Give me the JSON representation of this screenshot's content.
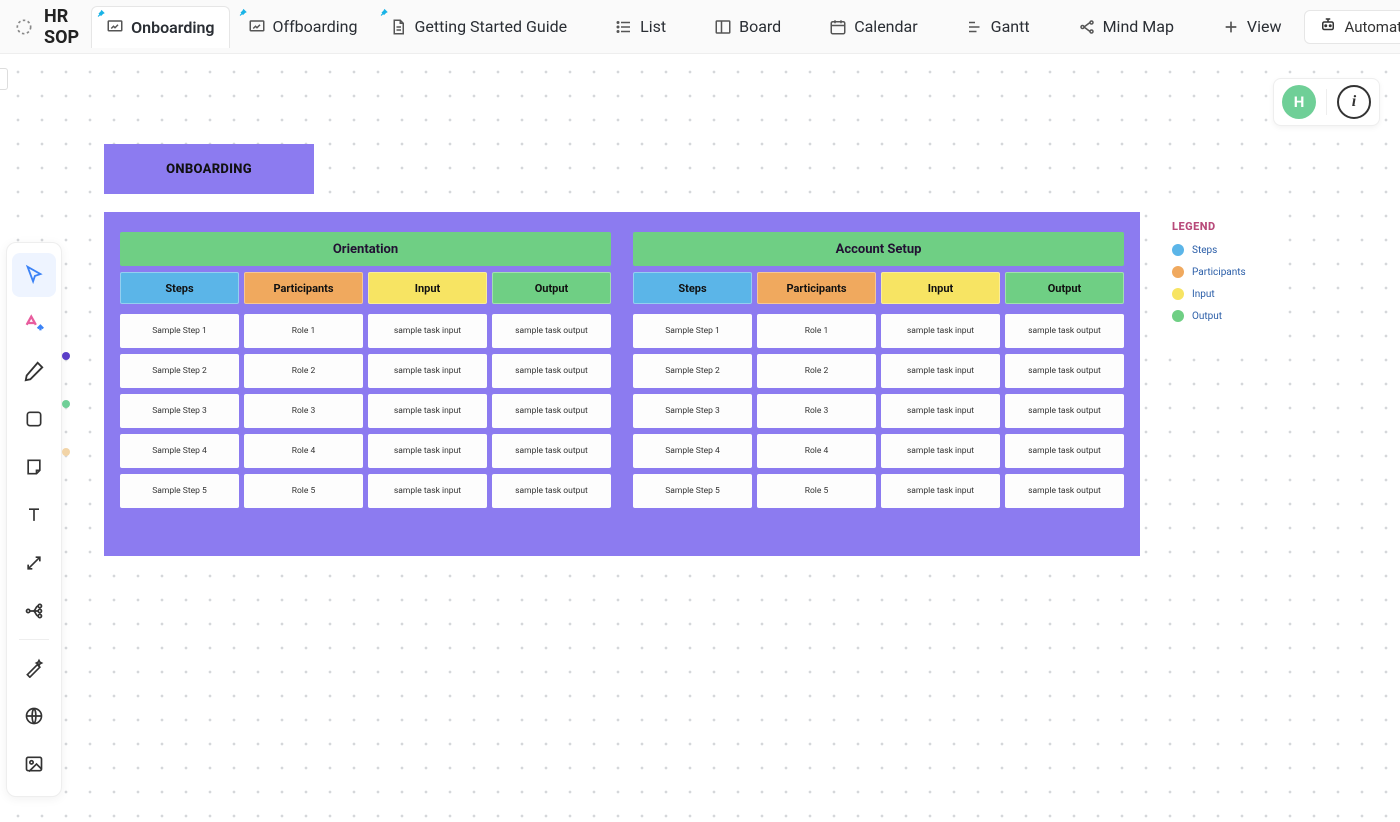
{
  "app": {
    "title": "HR SOP"
  },
  "tabs": [
    {
      "label": "Onboarding",
      "icon": "whiteboard",
      "pinned": true,
      "active": true
    },
    {
      "label": "Offboarding",
      "icon": "whiteboard",
      "pinned": true,
      "active": false
    },
    {
      "label": "Getting Started Guide",
      "icon": "doc",
      "pinned": true,
      "active": false
    },
    {
      "label": "List",
      "icon": "list",
      "pinned": false,
      "active": false
    },
    {
      "label": "Board",
      "icon": "board",
      "pinned": false,
      "active": false
    },
    {
      "label": "Calendar",
      "icon": "calendar",
      "pinned": false,
      "active": false
    },
    {
      "label": "Gantt",
      "icon": "gantt",
      "pinned": false,
      "active": false
    },
    {
      "label": "Mind Map",
      "icon": "mindmap",
      "pinned": false,
      "active": false
    },
    {
      "label": "View",
      "icon": "plus",
      "pinned": false,
      "active": false
    }
  ],
  "automate": {
    "label": "Automate"
  },
  "corner": {
    "avatar_letter": "H"
  },
  "tools": [
    "cursor",
    "ai",
    "pen",
    "rectangle",
    "sticky",
    "text",
    "connector",
    "branch",
    "magic",
    "web",
    "image"
  ],
  "board_title": "ONBOARDING",
  "columns": {
    "steps": {
      "label": "Steps",
      "color": "#5bb5e8"
    },
    "participants": {
      "label": "Participants",
      "color": "#f0a95e"
    },
    "input": {
      "label": "Input",
      "color": "#f7e463"
    },
    "output": {
      "label": "Output",
      "color": "#6fcf84"
    }
  },
  "sections": [
    {
      "title": "Orientation",
      "rows": [
        {
          "step": "Sample Step 1",
          "participant": "Role 1",
          "input": "sample task input",
          "output": "sample task output"
        },
        {
          "step": "Sample Step 2",
          "participant": "Role 2",
          "input": "sample task input",
          "output": "sample task output"
        },
        {
          "step": "Sample Step 3",
          "participant": "Role 3",
          "input": "sample task input",
          "output": "sample task output"
        },
        {
          "step": "Sample Step 4",
          "participant": "Role 4",
          "input": "sample task input",
          "output": "sample task output"
        },
        {
          "step": "Sample Step 5",
          "participant": "Role 5",
          "input": "sample task input",
          "output": "sample task output"
        }
      ]
    },
    {
      "title": "Account Setup",
      "rows": [
        {
          "step": "Sample Step 1",
          "participant": "Role 1",
          "input": "sample task input",
          "output": "sample task output"
        },
        {
          "step": "Sample Step 2",
          "participant": "Role 2",
          "input": "sample task input",
          "output": "sample task output"
        },
        {
          "step": "Sample Step 3",
          "participant": "Role 3",
          "input": "sample task input",
          "output": "sample task output"
        },
        {
          "step": "Sample Step 4",
          "participant": "Role 4",
          "input": "sample task input",
          "output": "sample task output"
        },
        {
          "step": "Sample Step 5",
          "participant": "Role 5",
          "input": "sample task input",
          "output": "sample task output"
        }
      ]
    }
  ],
  "legend": {
    "title": "LEGEND",
    "items": [
      {
        "label": "Steps",
        "color": "#5bb5e8"
      },
      {
        "label": "Participants",
        "color": "#f0a95e"
      },
      {
        "label": "Input",
        "color": "#f7e463"
      },
      {
        "label": "Output",
        "color": "#6fcf84"
      }
    ]
  }
}
